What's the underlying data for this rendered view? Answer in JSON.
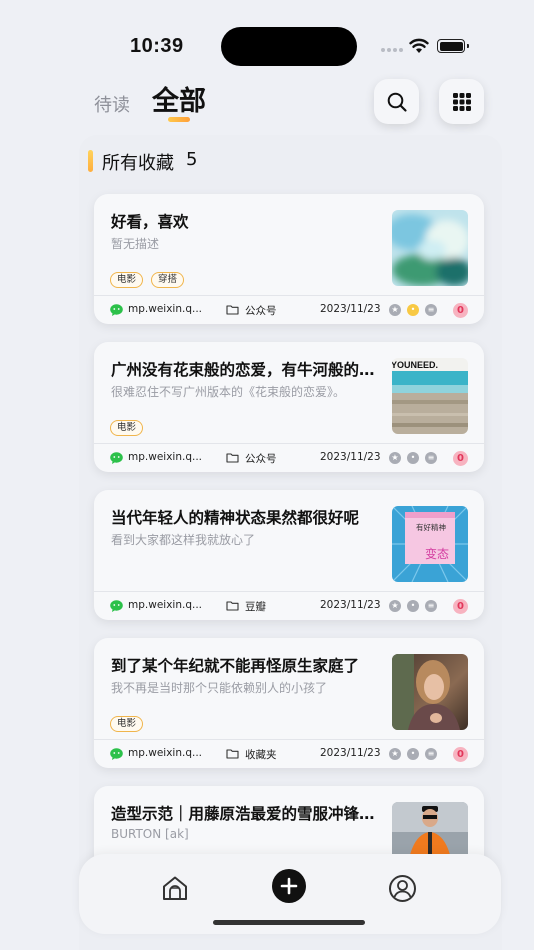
{
  "status_bar": {
    "time": "10:39"
  },
  "header": {
    "tabs": [
      {
        "label": "待读",
        "active": false
      },
      {
        "label": "全部",
        "active": true
      }
    ],
    "search_icon": "search-icon",
    "grid_icon": "grid-icon"
  },
  "section": {
    "title": "所有收藏",
    "count": "5"
  },
  "cards": [
    {
      "title": "好看，喜欢",
      "description": "暂无描述",
      "tags": [
        "电影",
        "穿搭"
      ],
      "source": "mp.weixin.q...",
      "folder": "公众号",
      "date": "2023/11/23",
      "count": "0",
      "thumbnail": "blurred-blue-green"
    },
    {
      "title": "广州没有花束般的恋爱，有牛河般的爱情",
      "description": "很难忍住不写广州版本的《花束般的恋爱》。",
      "tags": [
        "电影"
      ],
      "source": "mp.weixin.q...",
      "folder": "公众号",
      "date": "2023/11/23",
      "count": "0",
      "thumbnail": "beach",
      "thumbnail_text": "YOUNEED."
    },
    {
      "title": "当代年轻人的精神状态果然都很好呢",
      "description": "看到大家都这样我就放心了",
      "tags": [],
      "source": "mp.weixin.q...",
      "folder": "豆瓣",
      "date": "2023/11/23",
      "count": "0",
      "thumbnail": "pink-poster",
      "thumbnail_lines": [
        "有好精神",
        "变态"
      ]
    },
    {
      "title": "到了某个年纪就不能再怪原生家庭了",
      "description": "我不再是当时那个只能依赖别人的小孩了",
      "tags": [
        "电影"
      ],
      "source": "mp.weixin.q...",
      "folder": "收藏夹",
      "date": "2023/11/23",
      "count": "0",
      "thumbnail": "portrait"
    },
    {
      "title": "造型示范｜用藤原浩最爱的雪服冲锋衣穿搭",
      "description": "BURTON [ak]",
      "tags": [],
      "thumbnail": "orange-jacket"
    }
  ],
  "tabbar": {
    "items": [
      {
        "icon": "home-icon"
      },
      {
        "icon": "add-icon"
      },
      {
        "icon": "profile-icon"
      }
    ]
  },
  "colors": {
    "accent": "#ffb83f",
    "wechat_green": "#2cc14a",
    "count_badge_bg": "#f7b3c0",
    "count_badge_text": "#e2365a"
  }
}
